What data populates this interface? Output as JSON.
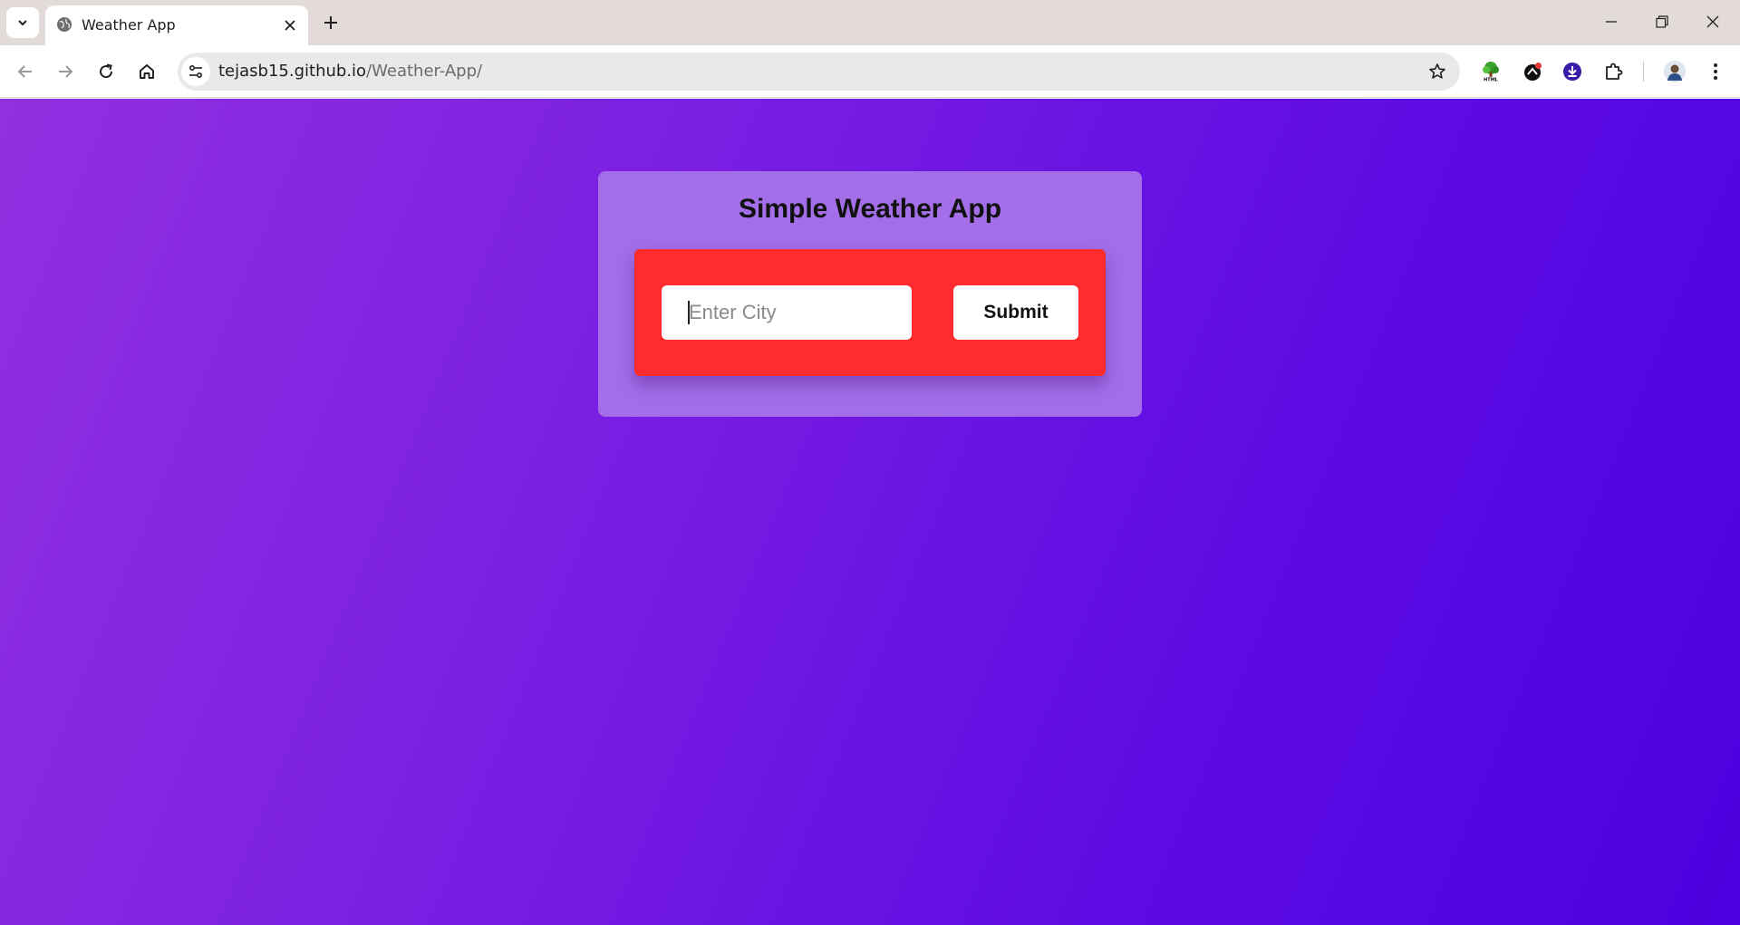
{
  "browser": {
    "tab": {
      "title": "Weather App"
    },
    "address": {
      "host": "tejasb15.github.io",
      "path": "/Weather-App/"
    },
    "extensions": [
      "html-tree-icon",
      "cloud-extension-icon",
      "download-extension-icon",
      "puzzle-extensions-icon",
      "profile-avatar"
    ]
  },
  "app": {
    "title": "Simple Weather App",
    "city_placeholder": "Enter City",
    "submit_label": "Submit"
  },
  "colors": {
    "card_bg": "#a36ee8",
    "form_bg": "#ff2b2e",
    "gradient_start": "#9030e0",
    "gradient_end": "#4c00df"
  }
}
